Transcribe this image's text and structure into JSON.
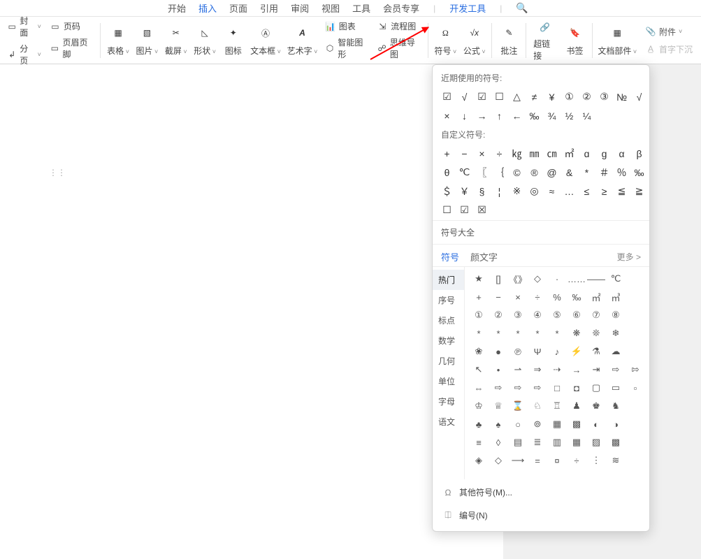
{
  "menu": {
    "tabs": [
      "开始",
      "插入",
      "页面",
      "引用",
      "审阅",
      "视图",
      "工具",
      "会员专享"
    ],
    "active_index": 1,
    "dev": "开发工具"
  },
  "ribbon": {
    "left": {
      "cover": "封面",
      "paging": "分页",
      "pageno": "页码",
      "headerfooter": "页眉页脚"
    },
    "buttons": {
      "table": "表格",
      "image": "图片",
      "screenshot": "截屏",
      "shape": "形状",
      "icon": "图标",
      "textbox": "文本框",
      "wordart": "艺术字",
      "chart": "图表",
      "flowchart": "流程图",
      "smartart": "智能图形",
      "mindmap": "思维导图",
      "symbol": "符号",
      "formula": "公式",
      "comment": "批注",
      "hyperlink": "超链接",
      "bookmark": "书签",
      "docparts": "文档部件",
      "attachment": "附件",
      "dropcap": "首字下沉"
    }
  },
  "panel": {
    "recent_title": "近期使用的符号:",
    "recent": [
      "☑",
      "√",
      "☑",
      "☐",
      "△",
      "≠",
      "¥",
      "①",
      "②",
      "③",
      "№",
      "√",
      "×",
      "↓",
      "→",
      "↑",
      "←",
      "‰",
      "¾",
      "½",
      "¼"
    ],
    "custom_title": "自定义符号:",
    "custom": [
      "+",
      "−",
      "×",
      "÷",
      "㎏",
      "㎜",
      "㎝",
      "㎡",
      "ɑ",
      "ɡ",
      "α",
      "β",
      "θ",
      "℃",
      "〖",
      "｛",
      "©",
      "®",
      "@",
      "&",
      "*",
      "＃",
      "％",
      "‰",
      "＄",
      "￥",
      "§",
      "¦",
      "※",
      "◎",
      "≈",
      "…",
      "≤",
      "≥",
      "≦",
      "≧",
      "☐",
      "☑",
      "☒"
    ],
    "all_symbols": "符号大全",
    "subtabs": {
      "symbol": "符号",
      "emoji": "颜文字",
      "more": "更多 >"
    },
    "categories": [
      "热门",
      "序号",
      "标点",
      "数学",
      "几何",
      "单位",
      "字母",
      "语文"
    ],
    "active_category": 0,
    "grid": [
      [
        "★",
        "[]",
        "《》",
        "◇",
        "·",
        "……",
        "——",
        "℃",
        ""
      ],
      [
        "+",
        "−",
        "×",
        "÷",
        "%",
        "‰",
        "㎡",
        "㎥",
        ""
      ],
      [
        "①",
        "②",
        "③",
        "④",
        "⑤",
        "⑥",
        "⑦",
        "⑧",
        ""
      ],
      [
        "*",
        "*",
        "*",
        "*",
        "*",
        "❋",
        "❊",
        "❄",
        ""
      ],
      [
        "❀",
        "●",
        "℗",
        "Ψ",
        "♪",
        "⚡",
        "⚗",
        "☁",
        ""
      ],
      [
        "↖",
        "•",
        "⇀",
        "⇒",
        "⇢",
        "→",
        "⇥",
        "⇨",
        "⇰"
      ],
      [
        "⇔",
        "⇨",
        "⇨",
        "⇨",
        "□",
        "◘",
        "▢",
        "▭",
        "▫"
      ],
      [
        "♔",
        "♕",
        "⌛",
        "♘",
        "♖",
        "♟",
        "♚",
        "♞",
        ""
      ],
      [
        "♣",
        "♠",
        "○",
        "⊚",
        "▦",
        "▩",
        "◐",
        "◑",
        ""
      ],
      [
        "≡",
        "◊",
        "▤",
        "≣",
        "▥",
        "▦",
        "▨",
        "▩",
        ""
      ],
      [
        "◈",
        "◇",
        "⟶",
        "=",
        "¤",
        "÷",
        "⋮",
        "≋",
        ""
      ]
    ],
    "footer": {
      "other": "其他符号(M)...",
      "numbering": "编号(N)"
    }
  }
}
